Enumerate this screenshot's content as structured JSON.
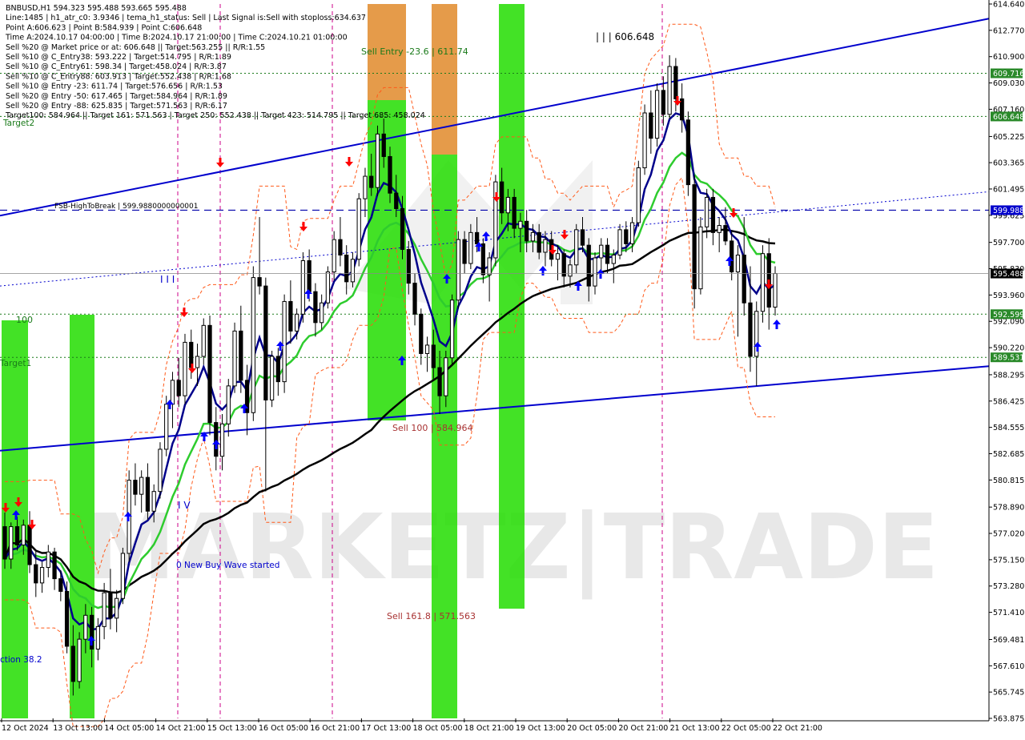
{
  "colors": {
    "background": "#ffffff",
    "candle": "#000000",
    "ma_fast": "#00008b",
    "ma_mid": "#2ecc2e",
    "ma_slow": "#000000",
    "channel": "#0000cd",
    "green_zone": "#22dd00",
    "orange_zone": "#e08a2a",
    "buy_arrow": "#0000ff",
    "sell_arrow": "#ff0000",
    "guide_dashed": "#cc0088",
    "target_green": "#1a7a1a",
    "fsb": "#0000aa",
    "watermark": "#d0d0d0",
    "price_tag_current": "#000000",
    "price_tag_fsb": "#0000cc",
    "price_tag_green": "#2a8a2a"
  },
  "info_lines": [
    "BNBUSD,H1  594.323 595.488 593.665 595.488",
    "Line:1485 | h1_atr_c0: 3.9346 | tema_h1_status: Sell | Last Signal is:Sell with stoploss:634.637",
    "Point A:606.623 | Point B:584.939 | Point C:606.648",
    "Time A:2024.10.17 04:00:00 | Time B:2024.10.17 21:00:00 | Time C:2024.10.21 01:00:00",
    "Sell %20 @ Market price or at: 606.648 || Target:563.255 || R/R:1.55",
    "Sell %10 @ C_Entry38: 593.222 | Target:514.795 | R/R:1.89",
    "Sell %10 @ C_Entry61: 598.34 | Target:458.024 | R/R:3.87",
    "Sell %10 @ C_Entry88: 603.913 | Target:552.438 | R/R:1.68",
    "Sell %10 @ Entry -23: 611.74 | Target:576.656 | R/R:1.53",
    "Sell %20 @ Entry -50: 617.465 | Target:584.964 | R/R:1.89",
    "Sell %20 @ Entry -88: 625.835 | Target:571.563 | R/R:6.17",
    "Target100: 584.964 || Target 161: 571.563 | Target 250: 552.438 || Target 423: 514.795 || Target 685: 458.024"
  ],
  "chart_labels": {
    "sell_entry": "Sell Entry -23.6 | 611.74",
    "point_c": "| | | 606.648",
    "fsb": "FSB-HighToBreak | 599.9880000000001",
    "sell_100": "Sell 100 | 584.964",
    "sell_161": "Sell 161.8 | 571.563",
    "wave": "0 New Buy Wave started",
    "wave_iii": "I I I",
    "wave_iv": "I V",
    "lvl_100": "100",
    "target1": "Target1",
    "target2": "Target2",
    "correction": "ction 38.2",
    "watermark": "MARKETZ|TRADE"
  },
  "chart_data": {
    "type": "candlestick",
    "symbol": "BNBUSD",
    "timeframe": "H1",
    "ylim": [
      563.875,
      614.64
    ],
    "price_ticks": [
      "614.640",
      "612.770",
      "610.900",
      "609.030",
      "607.160",
      "605.225",
      "603.365",
      "601.495",
      "599.625",
      "597.700",
      "595.830",
      "593.960",
      "592.090",
      "590.220",
      "588.295",
      "586.425",
      "584.555",
      "582.685",
      "580.815",
      "578.890",
      "577.020",
      "575.150",
      "573.280",
      "571.410",
      "569.481",
      "567.610",
      "565.745",
      "563.875"
    ],
    "time_ticks": [
      "12 Oct 2024",
      "13 Oct 13:00",
      "14 Oct 05:00",
      "14 Oct 21:00",
      "15 Oct 13:00",
      "16 Oct 05:00",
      "16 Oct 21:00",
      "17 Oct 13:00",
      "18 Oct 05:00",
      "18 Oct 21:00",
      "19 Oct 13:00",
      "20 Oct 05:00",
      "20 Oct 21:00",
      "21 Oct 13:00",
      "22 Oct 05:00",
      "22 Oct 21:00"
    ],
    "price_tags": [
      {
        "label": "609.716",
        "value": 609.716,
        "kind": "green"
      },
      {
        "label": "606.648",
        "value": 606.648,
        "kind": "green"
      },
      {
        "label": "599.988",
        "value": 599.988,
        "kind": "fsb"
      },
      {
        "label": "595.488",
        "value": 595.488,
        "kind": "current"
      },
      {
        "label": "592.599",
        "value": 592.599,
        "kind": "green"
      },
      {
        "label": "589.531",
        "value": 589.531,
        "kind": "green"
      }
    ],
    "horizontal_levels": [
      {
        "value": 609.716,
        "style": "dotted-green"
      },
      {
        "value": 606.648,
        "style": "dotted-green"
      },
      {
        "value": 599.988,
        "style": "dashed-blue"
      },
      {
        "value": 592.599,
        "style": "dotted-green"
      },
      {
        "value": 589.531,
        "style": "dotted-green"
      }
    ],
    "candles": [
      [
        577.5,
        578.5,
        574.5,
        575.2
      ],
      [
        575.2,
        577.8,
        574.5,
        577.5
      ],
      [
        577.5,
        578.2,
        575.8,
        576.2
      ],
      [
        576.2,
        578.0,
        575.5,
        577.6
      ],
      [
        577.6,
        578.6,
        574.2,
        574.8
      ],
      [
        574.8,
        575.8,
        572.5,
        573.5
      ],
      [
        573.5,
        575.0,
        572.8,
        574.6
      ],
      [
        574.6,
        576.2,
        573.9,
        575.7
      ],
      [
        575.7,
        576.0,
        573.0,
        573.8
      ],
      [
        573.8,
        574.4,
        572.2,
        572.9
      ],
      [
        572.9,
        573.6,
        568.5,
        569.0
      ],
      [
        569.0,
        570.5,
        565.5,
        566.5
      ],
      [
        566.5,
        570.0,
        566.0,
        569.5
      ],
      [
        569.5,
        572.0,
        568.5,
        571.2
      ],
      [
        571.2,
        571.8,
        567.5,
        568.8
      ],
      [
        568.8,
        571.0,
        568.0,
        570.4
      ],
      [
        570.4,
        573.5,
        569.5,
        572.8
      ],
      [
        572.8,
        574.5,
        570.2,
        571.0
      ],
      [
        571.0,
        573.0,
        570.0,
        572.4
      ],
      [
        572.4,
        576.0,
        572.0,
        575.6
      ],
      [
        575.6,
        581.5,
        575.0,
        580.8
      ],
      [
        580.8,
        582.0,
        579.0,
        579.8
      ],
      [
        579.8,
        581.5,
        578.5,
        581.0
      ],
      [
        581.0,
        582.0,
        578.0,
        578.6
      ],
      [
        578.6,
        580.5,
        577.8,
        580.0
      ],
      [
        580.0,
        583.5,
        579.5,
        583.0
      ],
      [
        583.0,
        586.8,
        582.5,
        586.2
      ],
      [
        586.2,
        588.5,
        584.5,
        587.9
      ],
      [
        587.9,
        589.5,
        586.0,
        586.8
      ],
      [
        586.8,
        591.2,
        586.2,
        590.6
      ],
      [
        590.6,
        591.5,
        588.0,
        588.8
      ],
      [
        588.8,
        590.5,
        587.5,
        589.6
      ],
      [
        589.6,
        592.3,
        589.0,
        591.8
      ],
      [
        591.8,
        592.5,
        584.0,
        584.9
      ],
      [
        584.9,
        586.0,
        581.5,
        582.5
      ],
      [
        582.5,
        585.5,
        581.5,
        584.8
      ],
      [
        584.8,
        588.0,
        583.9,
        587.5
      ],
      [
        587.5,
        592.0,
        587.0,
        591.4
      ],
      [
        591.4,
        593.2,
        587.0,
        587.9
      ],
      [
        587.9,
        589.0,
        584.0,
        585.6
      ],
      [
        585.6,
        596.0,
        585.0,
        595.2
      ],
      [
        595.2,
        599.5,
        594.0,
        594.6
      ],
      [
        594.6,
        595.2,
        580.0,
        586.5
      ],
      [
        586.5,
        590.0,
        586.0,
        589.6
      ],
      [
        589.6,
        590.2,
        586.8,
        587.8
      ],
      [
        587.8,
        594.0,
        587.0,
        593.5
      ],
      [
        593.5,
        595.0,
        590.5,
        591.4
      ],
      [
        591.4,
        593.0,
        590.8,
        592.6
      ],
      [
        592.6,
        597.0,
        592.0,
        596.4
      ],
      [
        596.4,
        597.2,
        593.5,
        594.2
      ],
      [
        594.2,
        594.8,
        591.0,
        592.0
      ],
      [
        592.0,
        594.0,
        591.5,
        593.4
      ],
      [
        593.4,
        596.0,
        593.0,
        595.6
      ],
      [
        595.6,
        598.5,
        595.0,
        597.9
      ],
      [
        597.9,
        599.5,
        596.0,
        596.8
      ],
      [
        596.8,
        597.5,
        594.0,
        594.9
      ],
      [
        594.9,
        597.0,
        594.5,
        596.5
      ],
      [
        596.5,
        601.2,
        596.0,
        600.8
      ],
      [
        600.8,
        603.0,
        599.5,
        602.4
      ],
      [
        602.4,
        604.0,
        601.0,
        601.6
      ],
      [
        601.6,
        606.0,
        601.0,
        605.4
      ],
      [
        605.4,
        606.5,
        603.0,
        603.8
      ],
      [
        603.8,
        604.5,
        600.5,
        601.2
      ],
      [
        601.2,
        602.5,
        599.5,
        600.1
      ],
      [
        600.1,
        601.0,
        596.5,
        597.2
      ],
      [
        597.2,
        597.8,
        594.0,
        594.8
      ],
      [
        594.8,
        595.5,
        591.8,
        592.6
      ],
      [
        592.6,
        593.0,
        589.0,
        589.8
      ],
      [
        589.8,
        591.0,
        588.5,
        590.4
      ],
      [
        590.4,
        591.5,
        588.0,
        588.8
      ],
      [
        588.8,
        590.0,
        585.5,
        586.8
      ],
      [
        586.8,
        590.0,
        586.0,
        589.5
      ],
      [
        589.5,
        594.0,
        589.0,
        593.6
      ],
      [
        593.6,
        598.5,
        593.0,
        597.9
      ],
      [
        597.9,
        598.5,
        595.5,
        596.2
      ],
      [
        596.2,
        599.0,
        595.8,
        598.4
      ],
      [
        598.4,
        599.5,
        597.0,
        597.6
      ],
      [
        597.6,
        598.0,
        594.8,
        595.4
      ],
      [
        595.4,
        597.0,
        593.5,
        596.6
      ],
      [
        596.6,
        602.5,
        596.0,
        602.0
      ],
      [
        602.0,
        603.0,
        599.0,
        599.8
      ],
      [
        599.8,
        601.5,
        598.5,
        600.9
      ],
      [
        600.9,
        601.5,
        598.0,
        598.7
      ],
      [
        598.7,
        599.8,
        597.0,
        599.2
      ],
      [
        599.2,
        600.0,
        597.0,
        597.8
      ],
      [
        597.8,
        599.0,
        597.0,
        598.4
      ],
      [
        598.4,
        599.0,
        596.5,
        597.0
      ],
      [
        597.0,
        598.5,
        596.0,
        597.9
      ],
      [
        597.9,
        598.5,
        596.0,
        596.5
      ],
      [
        596.5,
        597.5,
        595.0,
        596.9
      ],
      [
        596.9,
        597.2,
        594.5,
        595.3
      ],
      [
        595.3,
        596.5,
        594.5,
        596.1
      ],
      [
        596.1,
        599.0,
        595.5,
        598.6
      ],
      [
        598.6,
        599.5,
        597.0,
        597.5
      ],
      [
        597.5,
        598.0,
        593.5,
        594.6
      ],
      [
        594.6,
        597.0,
        594.0,
        596.6
      ],
      [
        596.6,
        598.0,
        595.5,
        597.5
      ],
      [
        597.5,
        598.0,
        595.5,
        596.2
      ],
      [
        596.2,
        597.2,
        594.8,
        596.8
      ],
      [
        596.8,
        599.0,
        596.5,
        598.6
      ],
      [
        598.6,
        599.2,
        597.0,
        597.6
      ],
      [
        597.6,
        599.5,
        597.0,
        599.1
      ],
      [
        599.1,
        603.5,
        598.8,
        603.0
      ],
      [
        603.0,
        607.5,
        602.5,
        606.9
      ],
      [
        606.9,
        608.5,
        604.0,
        605.1
      ],
      [
        605.1,
        609.0,
        604.5,
        608.5
      ],
      [
        608.5,
        609.5,
        606.0,
        606.8
      ],
      [
        606.8,
        611.0,
        606.5,
        610.2
      ],
      [
        610.2,
        610.8,
        607.0,
        607.9
      ],
      [
        607.9,
        609.0,
        605.5,
        606.4
      ],
      [
        606.4,
        607.0,
        601.0,
        601.8
      ],
      [
        601.8,
        602.5,
        593.0,
        594.4
      ],
      [
        594.4,
        599.5,
        594.0,
        598.8
      ],
      [
        598.8,
        601.5,
        598.0,
        600.9
      ],
      [
        600.9,
        601.5,
        597.5,
        598.4
      ],
      [
        598.4,
        599.5,
        597.0,
        598.9
      ],
      [
        598.9,
        600.2,
        597.5,
        597.8
      ],
      [
        597.8,
        598.5,
        595.0,
        595.6
      ],
      [
        595.6,
        597.5,
        591.0,
        596.8
      ],
      [
        596.8,
        599.5,
        592.5,
        593.4
      ],
      [
        593.4,
        596.0,
        588.5,
        589.6
      ],
      [
        589.6,
        593.5,
        587.5,
        592.8
      ],
      [
        592.8,
        597.5,
        592.0,
        596.9
      ],
      [
        596.9,
        598.0,
        591.5,
        593.1
      ],
      [
        593.1,
        596.0,
        592.5,
        595.488
      ]
    ]
  }
}
